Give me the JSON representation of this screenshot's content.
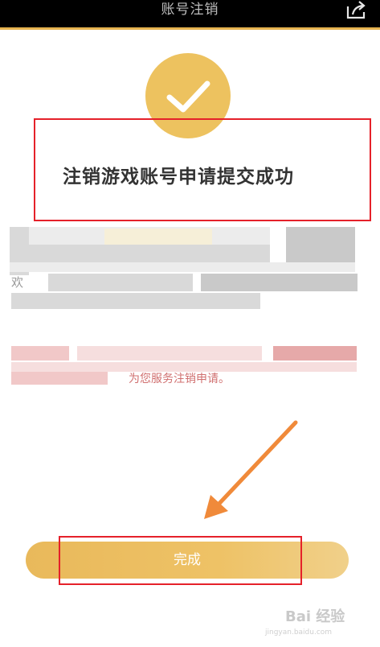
{
  "header": {
    "title": "账号注销"
  },
  "main": {
    "success_title": "注销游戏账号申请提交成功",
    "blur_fragment_1": "欢",
    "blur_fragment_2": "为您服务注销申请。"
  },
  "footer": {
    "done_label": "完成"
  },
  "watermark": {
    "brand": "Bai  经验",
    "url": "jingyan.baidu.com"
  },
  "colors": {
    "accent": "#e7b450",
    "highlight_red": "#e5212a",
    "arrow": "#f08a3a"
  }
}
